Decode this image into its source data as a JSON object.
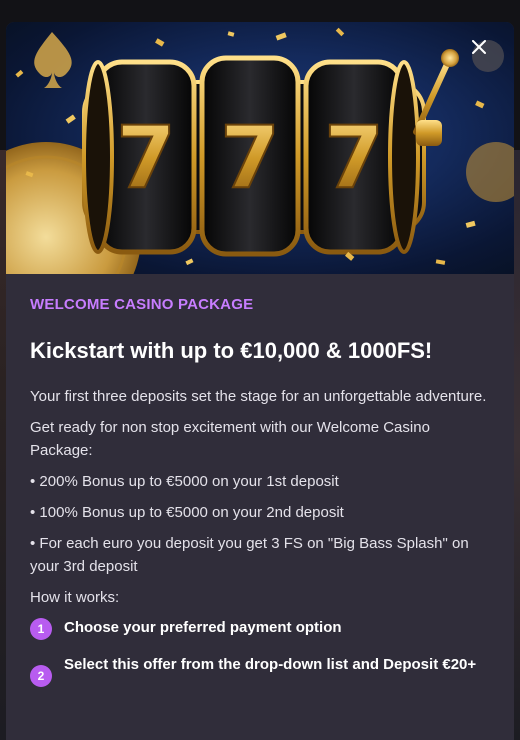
{
  "promo": {
    "eyebrow": "WELCOME CASINO PACKAGE",
    "headline": "Kickstart with up to €10,000 & 1000FS!",
    "paragraphs": [
      "Your first three deposits set the stage for an unforgettable adventure.",
      "Get ready for non stop excitement with our Welcome Casino Package:",
      "• 200% Bonus up to €5000 on your 1st deposit",
      "• 100% Bonus up to €5000 on your 2nd deposit",
      "• For each euro you deposit you get 3 FS on \"Big Bass Splash\" on your 3rd deposit",
      "How it works:"
    ],
    "steps": [
      {
        "number": "1",
        "text": "Choose your preferred payment option"
      },
      {
        "number": "2",
        "text": "Select this offer from the drop-down list and Deposit €20+"
      }
    ],
    "slot_digits": [
      "7",
      "7",
      "7"
    ]
  },
  "icons": {
    "close": "close-icon",
    "hero": "slot-machine-image"
  },
  "colors": {
    "accent": "#c77dff",
    "step_badge": "#b85cf0",
    "panel": "#302d3a"
  }
}
